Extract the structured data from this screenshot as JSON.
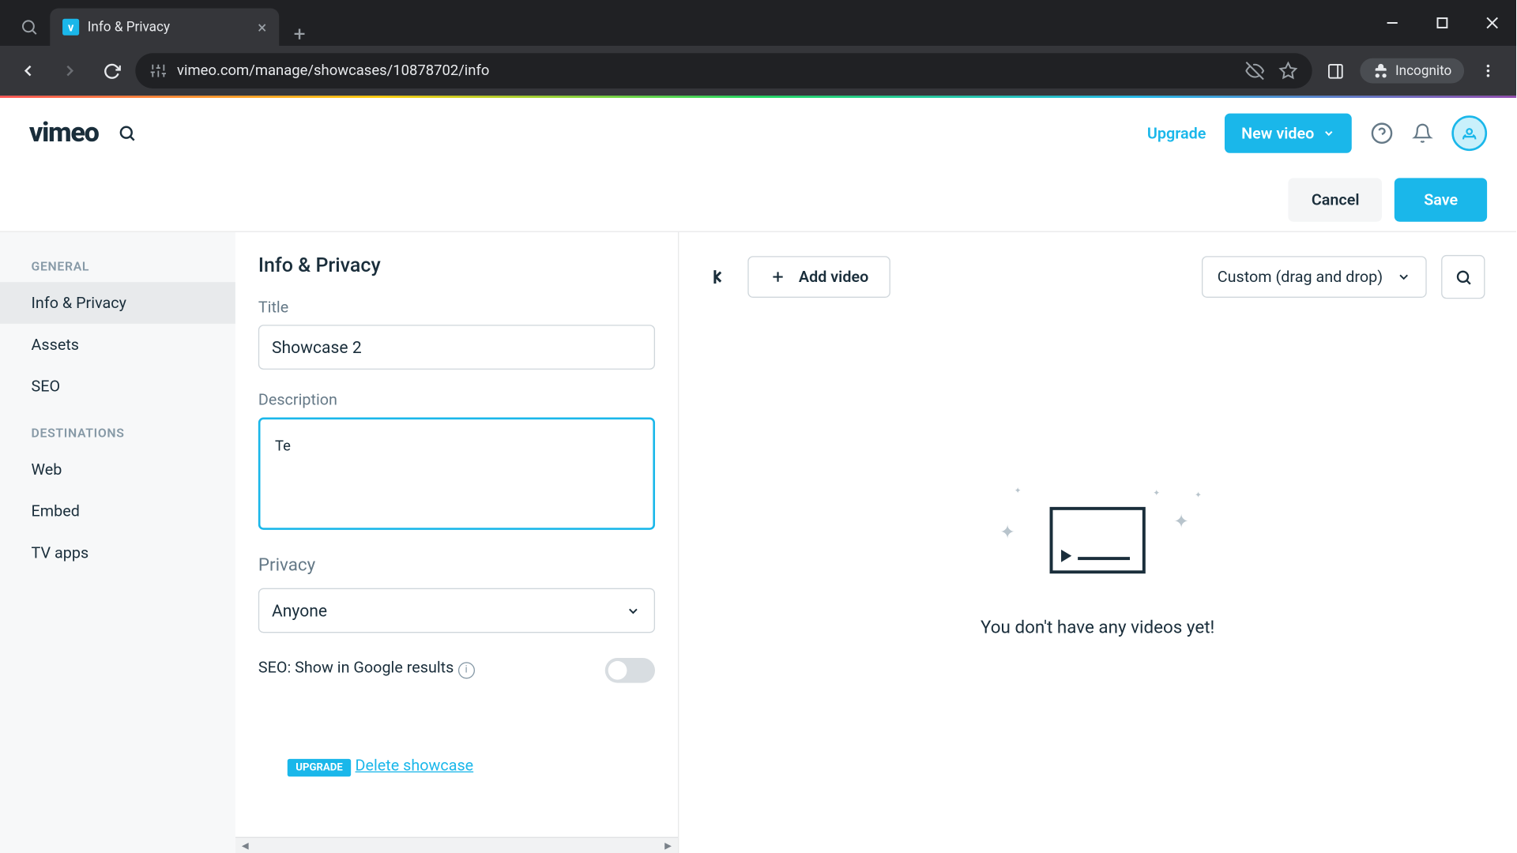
{
  "browser": {
    "tab_title": "Info & Privacy",
    "url": "vimeo.com/manage/showcases/10878702/info",
    "incognito_label": "Incognito"
  },
  "header": {
    "logo": "vimeo",
    "upgrade": "Upgrade",
    "new_video": "New video"
  },
  "actions": {
    "cancel": "Cancel",
    "save": "Save"
  },
  "sidebar": {
    "sections": [
      {
        "label": "GENERAL",
        "items": [
          "Info & Privacy",
          "Assets",
          "SEO"
        ]
      },
      {
        "label": "DESTINATIONS",
        "items": [
          "Web",
          "Embed",
          "TV apps"
        ]
      }
    ],
    "active": "Info & Privacy"
  },
  "form": {
    "page_title": "Info & Privacy",
    "title_label": "Title",
    "title_value": "Showcase 2",
    "description_label": "Description",
    "description_value": "Te",
    "privacy_label": "Privacy",
    "privacy_value": "Anyone",
    "seo_label": "SEO: Show in Google results",
    "upgrade_badge": "UPGRADE",
    "delete_link": "Delete showcase"
  },
  "right": {
    "add_video": "Add video",
    "sort_value": "Custom (drag and drop)",
    "empty_message": "You don't have any videos yet!"
  }
}
